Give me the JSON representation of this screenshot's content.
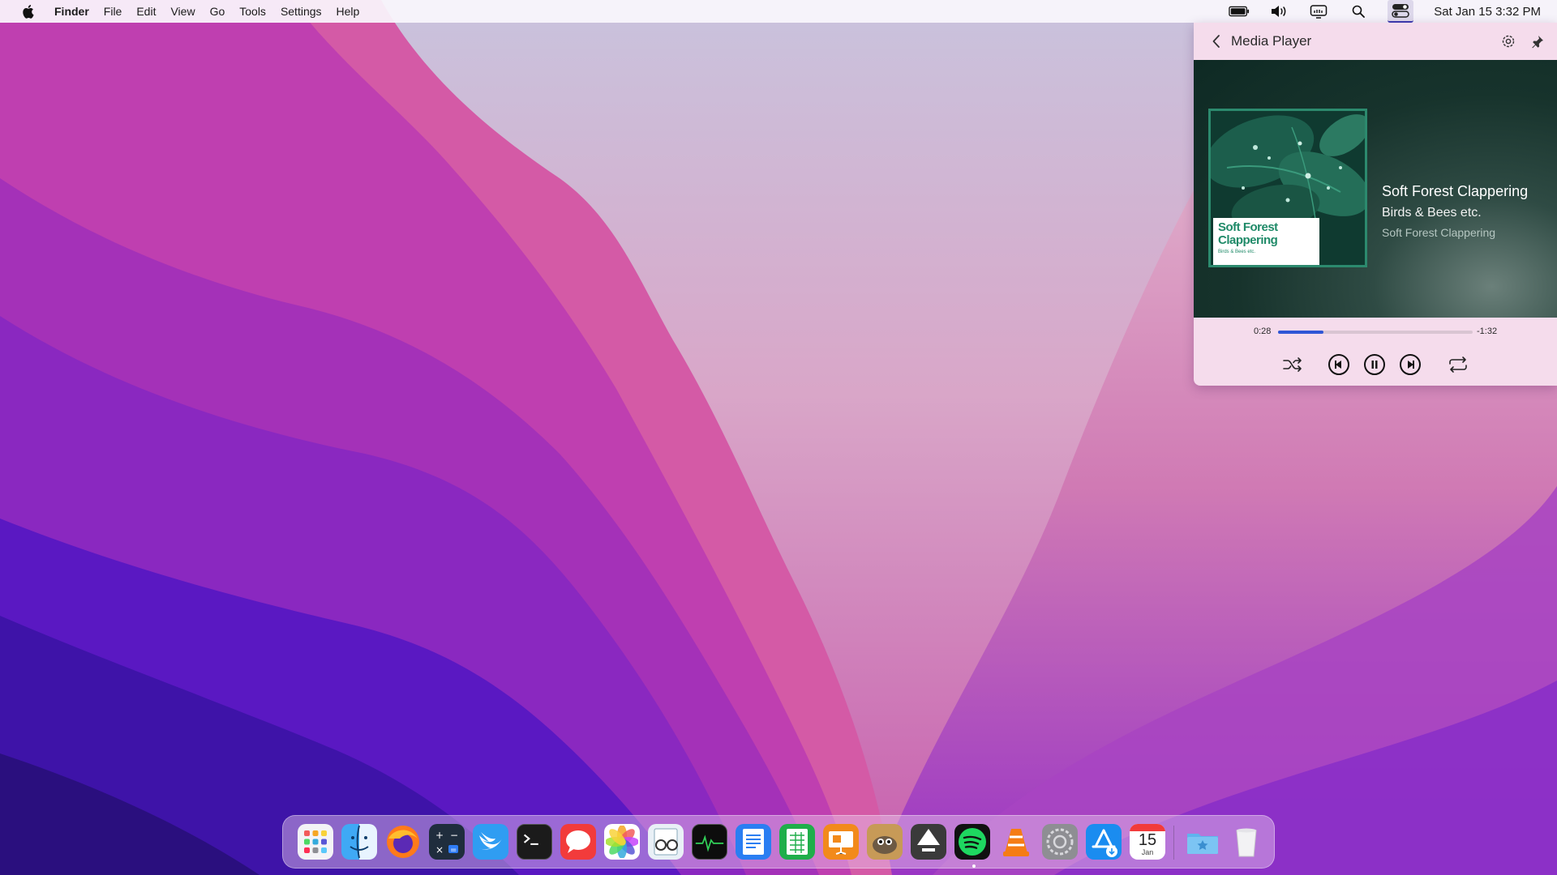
{
  "menubar": {
    "app_name": "Finder",
    "menus": [
      "File",
      "Edit",
      "View",
      "Go",
      "Tools",
      "Settings",
      "Help"
    ],
    "clock": "Sat Jan 15  3:32 PM"
  },
  "player": {
    "title": "Media Player",
    "cover_title": "Soft Forest Clappering",
    "cover_artist": "Birds & Bees etc.",
    "track_title": "Soft Forest Clappering",
    "track_artist": "Birds & Bees etc.",
    "track_album": "Soft Forest Clappering",
    "elapsed": "0:28",
    "remaining": "-1:32",
    "progress_fraction": 0.233,
    "accent_color": "#2f56d6"
  },
  "dock": {
    "calendar_day": "15",
    "calendar_month": "Jan",
    "apps": [
      "launchpad",
      "finder",
      "firefox",
      "calculator",
      "swift",
      "terminal",
      "messages",
      "photos",
      "preview",
      "activity-monitor",
      "writer",
      "calc",
      "impress",
      "gimp",
      "inkscape",
      "spotify",
      "vlc",
      "system-settings",
      "app-store",
      "calendar",
      "downloads-folder",
      "trash"
    ]
  }
}
